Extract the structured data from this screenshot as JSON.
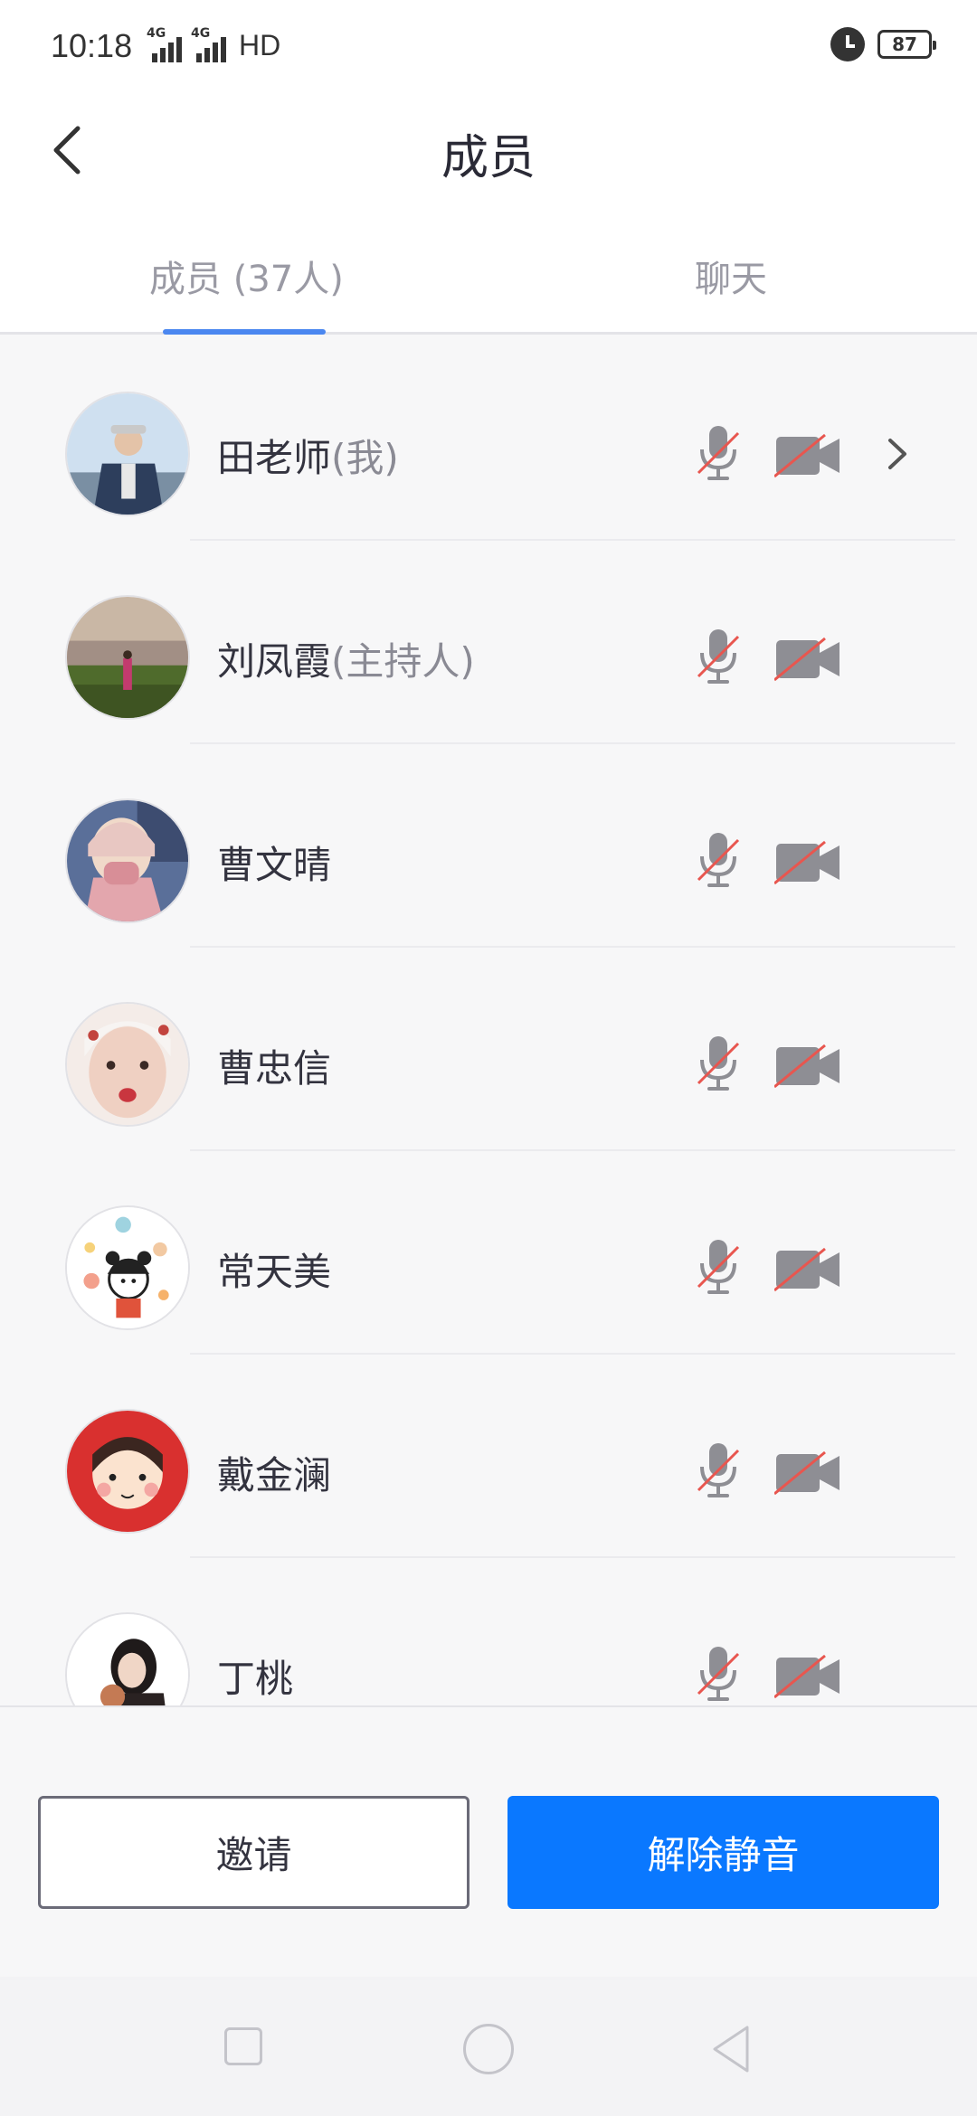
{
  "status_bar": {
    "time": "10:18",
    "network_1": "4G",
    "network_2": "4G",
    "hd": "HD",
    "battery": "87"
  },
  "header": {
    "title": "成员",
    "back_icon": "chevron-left-icon"
  },
  "tabs": [
    {
      "label": "成员 (37人)",
      "active": true
    },
    {
      "label": "聊天",
      "active": false
    }
  ],
  "members": [
    {
      "name": "田老师",
      "role": "(我)",
      "mic": "muted",
      "camera": "off",
      "has_detail": true
    },
    {
      "name": "刘凤霞",
      "role": "(主持人)",
      "mic": "muted",
      "camera": "off",
      "has_detail": false
    },
    {
      "name": "曹文晴",
      "role": "",
      "mic": "muted",
      "camera": "off",
      "has_detail": false
    },
    {
      "name": "曹忠信",
      "role": "",
      "mic": "muted",
      "camera": "off",
      "has_detail": false
    },
    {
      "name": "常天美",
      "role": "",
      "mic": "muted",
      "camera": "off",
      "has_detail": false
    },
    {
      "name": "戴金澜",
      "role": "",
      "mic": "muted",
      "camera": "off",
      "has_detail": false
    },
    {
      "name": "丁桃",
      "role": "",
      "mic": "muted",
      "camera": "off",
      "has_detail": false
    }
  ],
  "actions": {
    "invite_label": "邀请",
    "unmute_label": "解除静音"
  },
  "colors": {
    "primary": "#0a78ff",
    "tab_indicator": "#4b87f0",
    "muted_slash": "#e8564f",
    "icon_gray": "#8e8e94"
  }
}
